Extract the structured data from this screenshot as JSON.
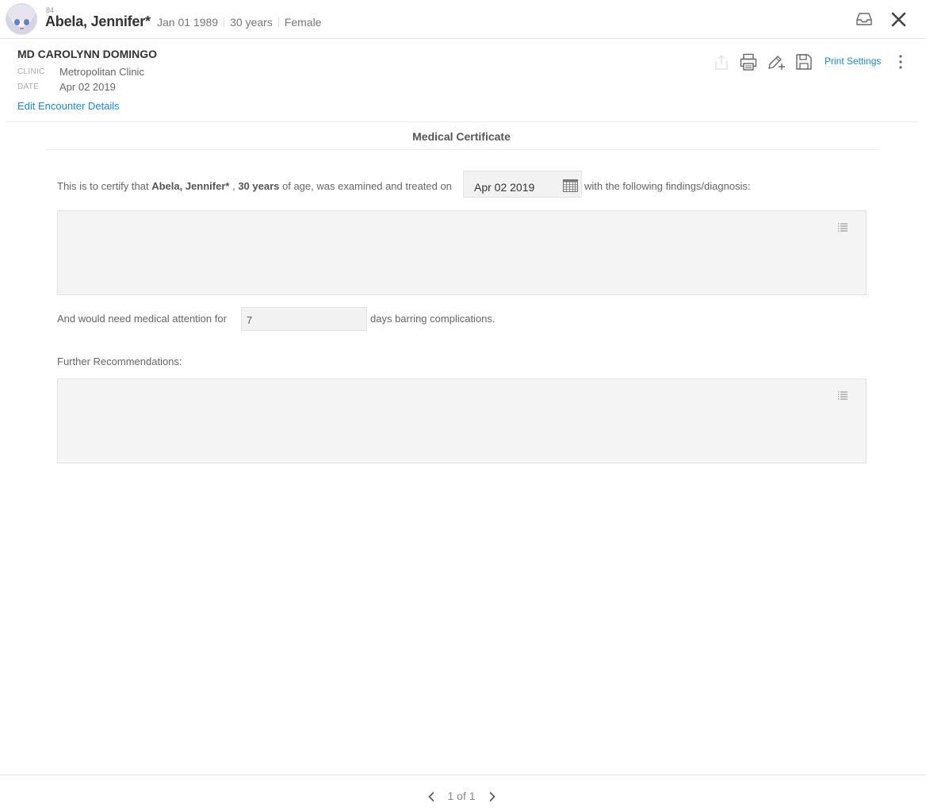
{
  "header": {
    "patient_id": "84",
    "patient_name": "Abela, Jennifer*",
    "dob": "Jan 01 1989",
    "age": "30 years",
    "sex": "Female",
    "icons": [
      "avatar",
      "inbox-icon",
      "close-icon"
    ]
  },
  "encounter": {
    "doctor": "MD CAROLYNN DOMINGO",
    "clinic_label": "CLINIC",
    "clinic_value": "Metropolitan Clinic",
    "date_label": "DATE",
    "date_value": "Apr 02 2019",
    "edit_link": "Edit Encounter Details",
    "toolbar": {
      "icons": [
        "share-icon",
        "print-icon",
        "edit-add-icon",
        "save-icon",
        "more-vertical-icon"
      ],
      "print_settings": "Print Settings"
    }
  },
  "document": {
    "title": "Medical Certificate",
    "certify_prefix": "This is to certify that ",
    "certify_name": "Abela, Jennifer*",
    "certify_sep": " , ",
    "certify_age": "30 years",
    "certify_suffix": " of age, was examined and treated on",
    "exam_date": "Apr 02 2019",
    "certify_tail": "with the following findings/diagnosis:",
    "findings_value": "",
    "attention_prefix": "And would need medical attention for",
    "days_value": "7",
    "attention_suffix": "days barring complications.",
    "recommendations_label": "Further Recommendations:",
    "recommendations_value": ""
  },
  "footer": {
    "pager": "1 of 1"
  },
  "colors": {
    "link": "#1e88c8",
    "input_bg": "#f2f2f2"
  }
}
